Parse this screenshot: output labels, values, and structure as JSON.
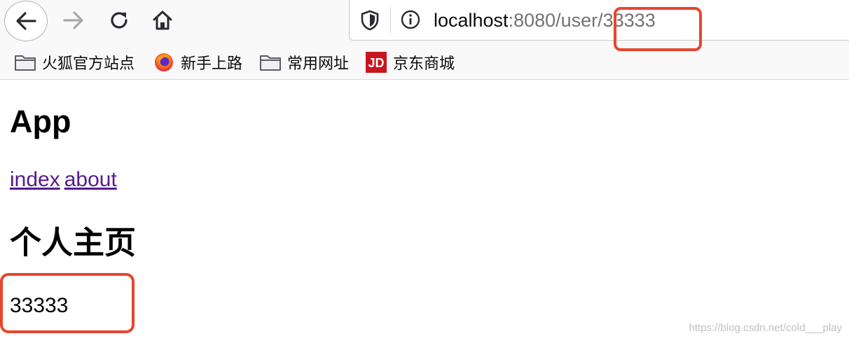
{
  "browser": {
    "url": {
      "host": "localhost",
      "rest": ":8080/user/",
      "param": "33333"
    },
    "bookmarks": [
      {
        "label": "火狐官方站点",
        "icon": "folder-icon"
      },
      {
        "label": "新手上路",
        "icon": "firefox-icon"
      },
      {
        "label": "常用网址",
        "icon": "folder-icon"
      },
      {
        "label": "京东商城",
        "icon": "jd-logo-icon",
        "logo_text": "JD"
      }
    ],
    "colors": {
      "highlight": "#e8452c",
      "link_visited": "#551a8b",
      "jd_red": "#c9151e"
    }
  },
  "page": {
    "app_title": "App",
    "links": [
      {
        "label": "index"
      },
      {
        "label": "about"
      }
    ],
    "heading": "个人主页",
    "user_id": "33333"
  },
  "watermark": "https://blog.csdn.net/cold___play"
}
